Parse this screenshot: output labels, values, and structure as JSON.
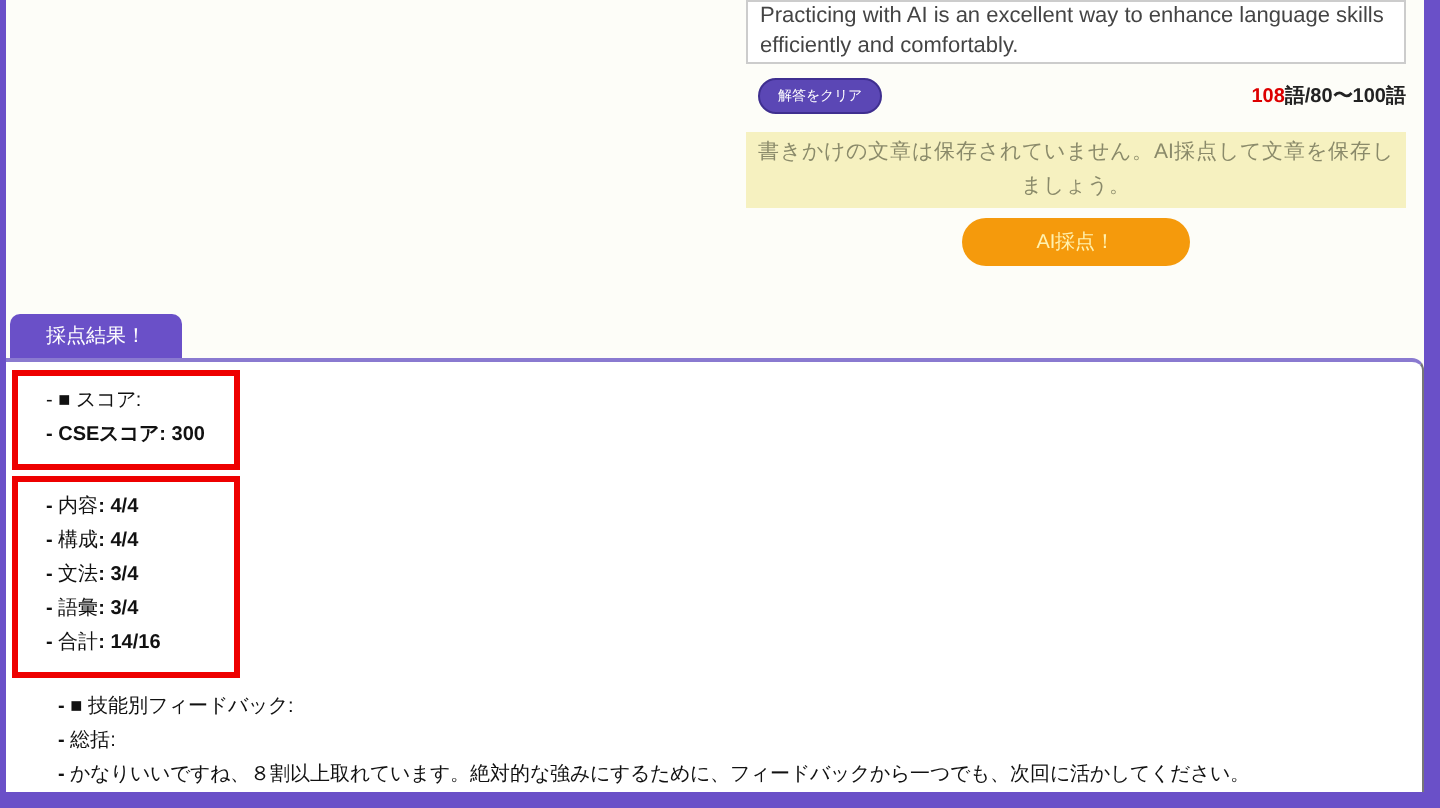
{
  "essay": {
    "value": "Practicing with AI is an excellent way to enhance language skills efficiently and comfortably."
  },
  "clear_button": "解答をクリア",
  "word_count": {
    "current": "108",
    "rest": "語/80〜100語"
  },
  "notice": "書きかけの文章は保存されていません。AI採点して文章を保存しましょう。",
  "grade_button": "AI採点！",
  "tabs": [
    {
      "label": "採点結果！",
      "selected": true
    }
  ],
  "result_groups": [
    {
      "highlighted": true,
      "lines": [
        "- ■ スコア:",
        "**- CSEスコア: 300**"
      ]
    },
    {
      "highlighted": true,
      "lines": [
        "**-** 内容**: 4/4**",
        "**-** 構成**: 4/4**",
        "**-** 文法**: 3/4**",
        "**-** 語彙**: 3/4**",
        "**-** 合計**: 14/16**"
      ]
    },
    {
      "highlighted": false,
      "lines": [
        "**-** ■ 技能別フィードバック:",
        "**-** 総括:",
        "**-** かなりいいですね、８割以上取れています。絶対的な強みにするために、フィードバックから一つでも、次回に活かしてください。"
      ]
    }
  ]
}
